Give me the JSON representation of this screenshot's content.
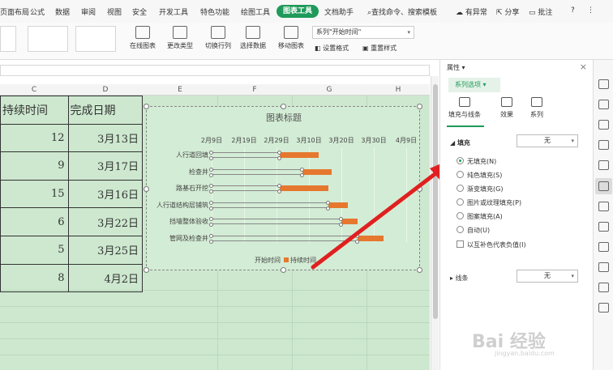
{
  "menubar": {
    "items": [
      "页面布局",
      "公式",
      "数据",
      "审阅",
      "视图",
      "安全",
      "开发工具",
      "特色功能",
      "绘图工具"
    ],
    "active_tab": "图表工具",
    "after_active": "文档助手",
    "search": "查找命令、搜索模板",
    "right": [
      "有异常",
      "分享",
      "批注",
      "?"
    ]
  },
  "ribbon": {
    "buttons": [
      "在线图表",
      "更改类型",
      "切换行列",
      "选择数据",
      "移动图表"
    ],
    "series_select": "系列\"开始时间\"",
    "small_buttons": [
      "设置格式",
      "重置样式"
    ]
  },
  "columns": [
    "C",
    "D",
    "E",
    "F",
    "G",
    "H"
  ],
  "table": {
    "headers": [
      "持续时间",
      "完成日期"
    ],
    "rows": [
      {
        "duration": "12",
        "date": "3月13日"
      },
      {
        "duration": "9",
        "date": "3月17日"
      },
      {
        "duration": "15",
        "date": "3月16日"
      },
      {
        "duration": "6",
        "date": "3月22日"
      },
      {
        "duration": "5",
        "date": "3月25日"
      },
      {
        "duration": "8",
        "date": "4月2日"
      }
    ]
  },
  "chart_data": {
    "type": "bar",
    "title": "图表标题",
    "x_ticks": [
      "2月9日",
      "2月19日",
      "2月29日",
      "3月10日",
      "3月20日",
      "3月30日",
      "4月9日"
    ],
    "categories": [
      "人行道回填",
      "检查井",
      "路基石开挖",
      "人行道结构层铺筑",
      "挡墙整体验收",
      "管网及检查井"
    ],
    "series": [
      {
        "name": "开始时间",
        "values": [
          "3月1日",
          "3月8日",
          "3月1日",
          "3月16日",
          "3月20日",
          "3月25日"
        ]
      },
      {
        "name": "持续时间",
        "values": [
          12,
          9,
          15,
          6,
          5,
          8
        ]
      }
    ],
    "legend": [
      "开始时间",
      "持续时间"
    ],
    "colors": {
      "duration": "#e5782e"
    }
  },
  "pane": {
    "title": "属性",
    "series_tab": "系列选项",
    "tabs": [
      "填充与线条",
      "效果",
      "系列"
    ],
    "fill_label": "填充",
    "fill_dropdown": "无",
    "options": [
      "无填充(N)",
      "纯色填充(S)",
      "渐变填充(G)",
      "图片或纹理填充(P)",
      "图案填充(A)",
      "自动(U)"
    ],
    "invert_negative": "以互补色代表负值(I)",
    "line_label": "线条",
    "line_dropdown": "无"
  },
  "watermark": {
    "text": "Bai 经验",
    "sub": "jingyan.baidu.com"
  }
}
